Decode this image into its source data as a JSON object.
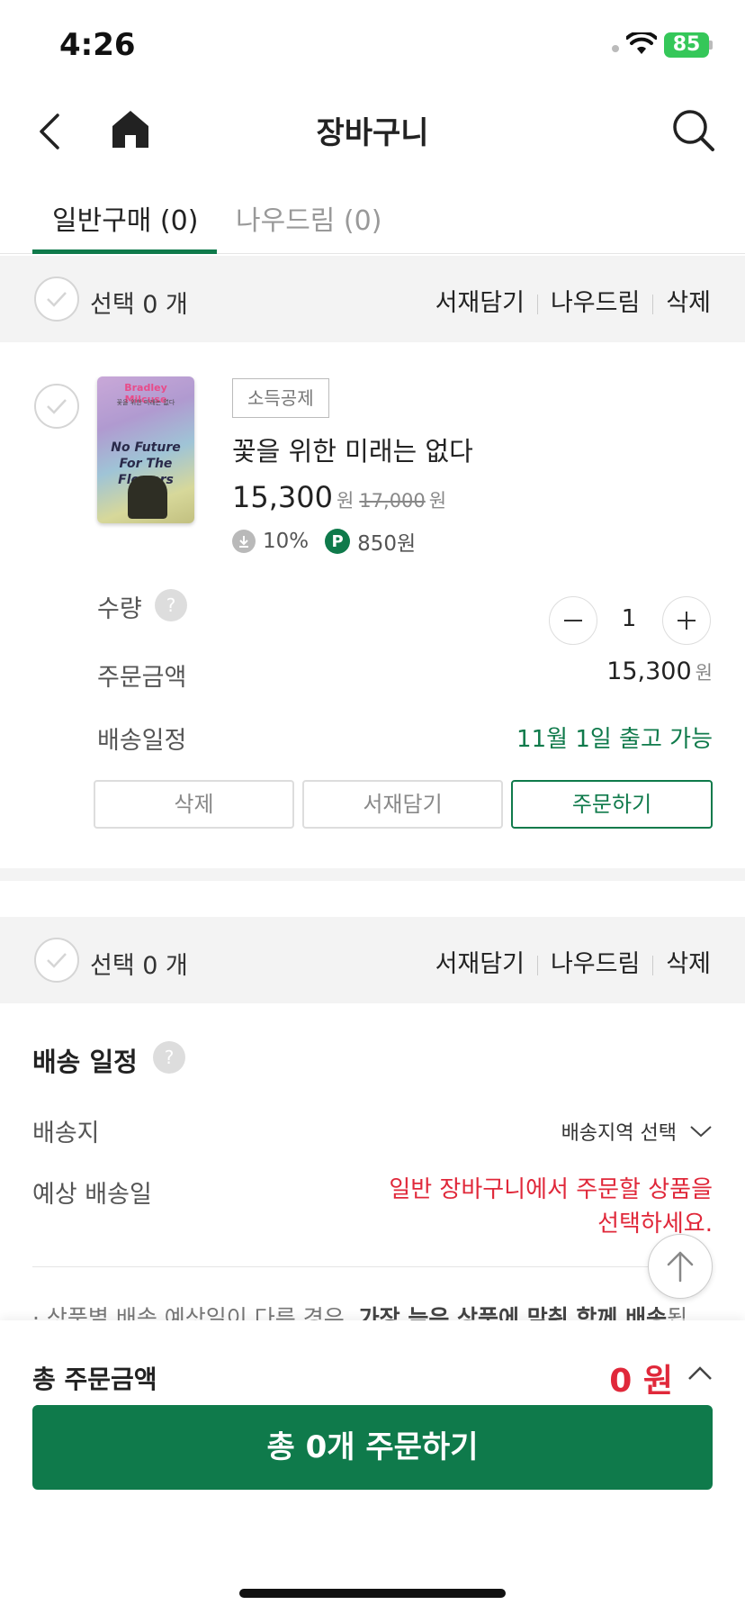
{
  "status_bar": {
    "time": "4:26",
    "battery": "85"
  },
  "header": {
    "title": "장바구니"
  },
  "tabs": [
    {
      "label": "일반구매 (0)",
      "active": true
    },
    {
      "label": "나우드림 (0)",
      "active": false
    }
  ],
  "select_bar": {
    "label": "선택 0 개",
    "actions": [
      "서재담기",
      "나우드림",
      "삭제"
    ]
  },
  "item": {
    "badge": "소득공제",
    "title": "꽃을 위한 미래는 없다",
    "price": "15,300",
    "price_unit": "원",
    "original_price": "17,000",
    "original_unit": "원",
    "discount": "10%",
    "point_icon": "P",
    "points": "850원",
    "cover_author": "Bradley Milcuse",
    "cover_subtitle": "꽃을 위한 미래는 없다",
    "cover_title": "No Future For The Flowers",
    "quantity_label": "수량",
    "quantity": "1",
    "order_amount_label": "주문금액",
    "order_amount": "15,300",
    "order_amount_unit": "원",
    "ship_label": "배송일정",
    "ship_value": "11월 1일 출고 가능",
    "buttons": {
      "delete": "삭제",
      "wishlist": "서재담기",
      "order": "주문하기"
    }
  },
  "select_bar_2": {
    "label": "선택 0 개",
    "actions": [
      "서재담기",
      "나우드림",
      "삭제"
    ]
  },
  "shipping": {
    "title": "배송 일정",
    "destination_label": "배송지",
    "destination_value": "배송지역 선택",
    "eta_label": "예상 배송일",
    "eta_line1": "일반 장바구니에서 주문할 상품을",
    "eta_line2": "선택하세요.",
    "note_normal": "상품별 배송 예상일이 다른 경우,",
    "note_bold": "가장 늦은 상품에 맞춰 함께 배송",
    "note_end": "됩"
  },
  "footer": {
    "total_label": "총 주문금액",
    "total_value": "0 원",
    "order_button": "총 0개 주문하기"
  },
  "colors": {
    "brand_green": "#0f7a4b",
    "alert_red": "#e0283a"
  }
}
